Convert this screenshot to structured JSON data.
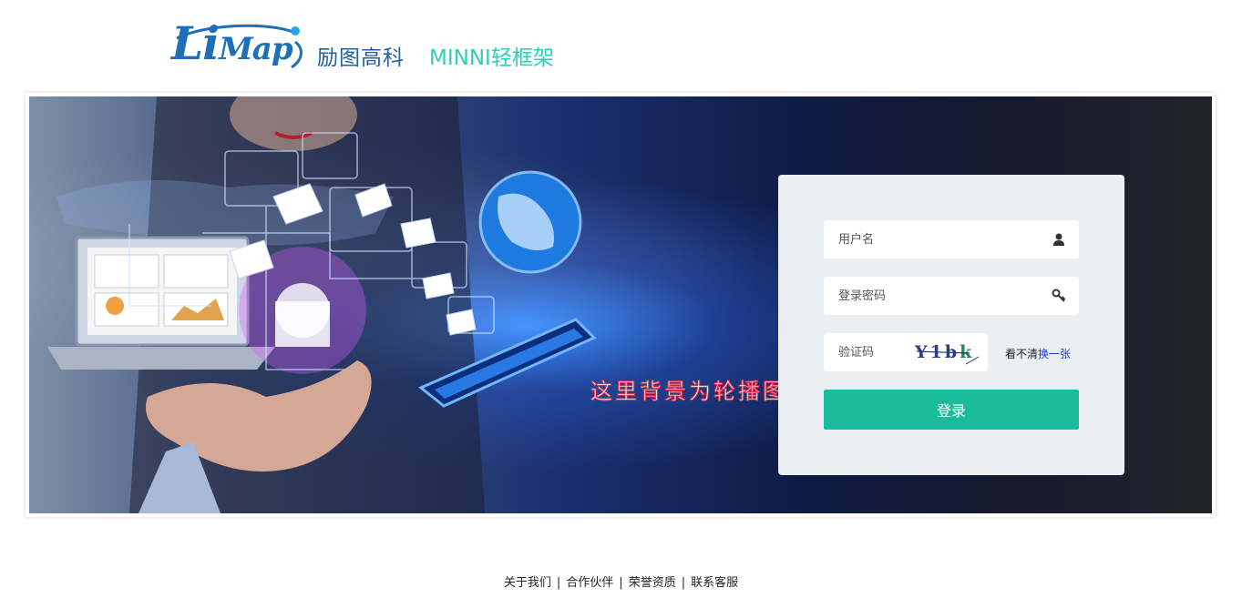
{
  "header": {
    "logo_text_big": "Li",
    "logo_text_small": "Map",
    "brand_cn": "励图高科",
    "brand_product": "MINNI轻框架"
  },
  "banner": {
    "caption": "这里背景为轮播图"
  },
  "login": {
    "username_placeholder": "用户名",
    "password_placeholder": "登录密码",
    "captcha_placeholder": "验证码",
    "captcha_text": [
      "Y",
      "1",
      "b",
      "k"
    ],
    "refresh_prefix": "看不清",
    "refresh_link": "换一张",
    "submit_label": "登录",
    "icons": {
      "username": "user-icon",
      "password": "key-icon"
    }
  },
  "footer": {
    "links": [
      "关于我们",
      "合作伙伴",
      "荣誉资质",
      "联系客服"
    ],
    "separator": "|"
  },
  "colors": {
    "brand_blue": "#1f5fa6",
    "brand_teal": "#2ecfb4",
    "button": "#1abc9c",
    "panel": "#eceff1",
    "link": "#1a3fd0"
  }
}
